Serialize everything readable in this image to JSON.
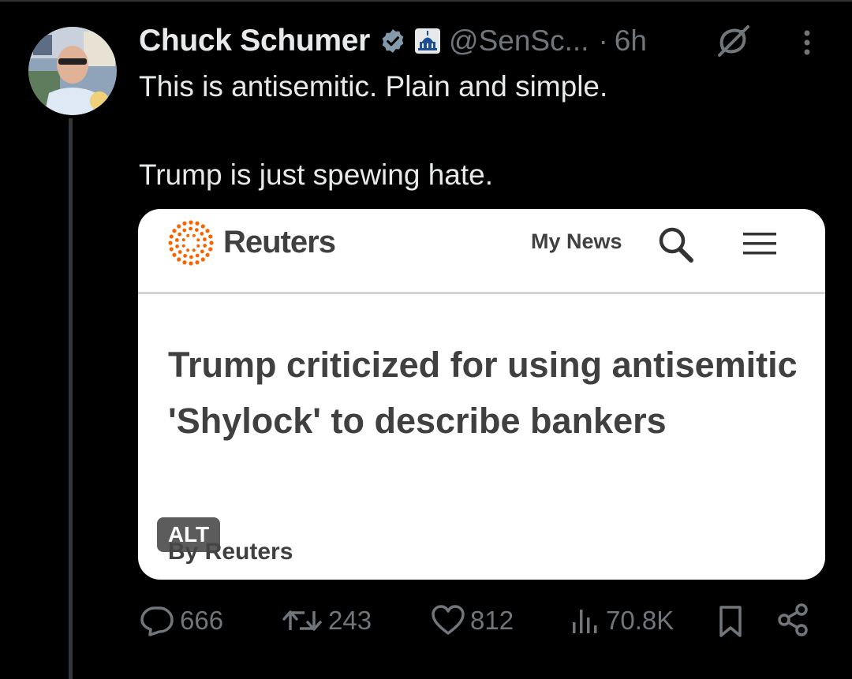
{
  "tweet": {
    "author_name": "Chuck Schumer",
    "handle": "@SenSc...",
    "separator": "·",
    "time": "6h",
    "text_line1": "This is antisemitic. Plain and simple.",
    "text_line2": "Trump is just spewing hate.",
    "icons": {
      "verified": "verified-badge-icon",
      "government": "capitol-building-icon",
      "grok": "grok-icon",
      "more": "more-vertical-icon"
    }
  },
  "media_card": {
    "brand": "Reuters",
    "nav_label": "My News",
    "headline": "Trump criticized for using antisemitic 'Shylock' to describe bankers",
    "byline": "By Reuters",
    "alt_badge": "ALT",
    "icons": {
      "logo": "reuters-dot-logo",
      "search": "search-icon",
      "menu": "hamburger-menu-icon"
    }
  },
  "actions": {
    "replies": "666",
    "retweets": "243",
    "likes": "812",
    "views": "70.8K",
    "icons": {
      "reply": "reply-icon",
      "retweet": "retweet-icon",
      "like": "heart-icon",
      "views": "views-chart-icon",
      "bookmark": "bookmark-icon",
      "share": "share-icon"
    }
  },
  "colors": {
    "background": "#000000",
    "text_primary": "#e7e9ea",
    "text_secondary": "#71767b",
    "verified_badge": "#829aab",
    "reuters_orange": "#fa6400",
    "card_text": "#404040"
  }
}
